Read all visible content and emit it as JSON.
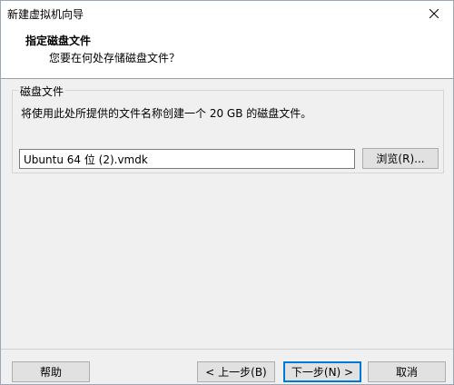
{
  "window": {
    "title": "新建虚拟机向导"
  },
  "header": {
    "title": "指定磁盘文件",
    "subtitle": "您要在何处存储磁盘文件？"
  },
  "disk_group": {
    "legend": "磁盘文件",
    "description": "将使用此处所提供的文件名称创建一个 20 GB 的磁盘文件。",
    "file_value": "Ubuntu 64 位 (2).vmdk",
    "browse_label": "浏览(R)..."
  },
  "footer": {
    "help_label": "帮助",
    "back_label": "< 上一步(B)",
    "next_label": "下一步(N) >",
    "cancel_label": "取消"
  },
  "icons": {
    "close": "close-icon"
  },
  "colors": {
    "accent": "#0078d7",
    "background": "#f0f0f0",
    "header_background": "#ffffff"
  }
}
